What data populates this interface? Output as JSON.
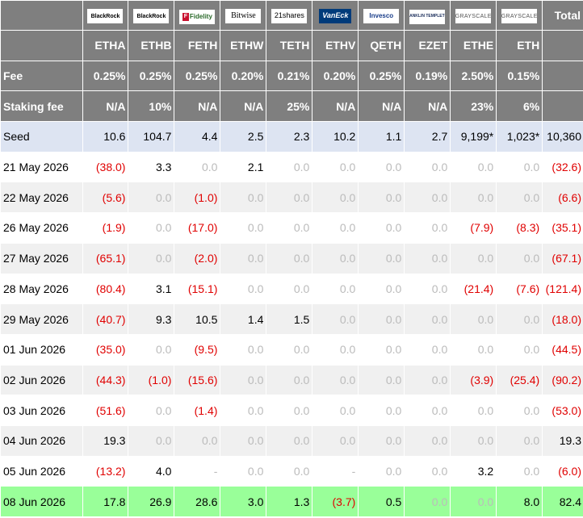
{
  "logos": [
    {
      "name": "blackrock-logo",
      "text": "BlackRock"
    },
    {
      "name": "blackrock-logo",
      "text": "BlackRock"
    },
    {
      "name": "fidelity-logo",
      "text": "Fidelity"
    },
    {
      "name": "bitwise-logo",
      "text": "Bitwise"
    },
    {
      "name": "21shares-logo",
      "text": "21shares"
    },
    {
      "name": "vaneck-logo",
      "text": "VanEck"
    },
    {
      "name": "invesco-logo",
      "text": "Invesco"
    },
    {
      "name": "franklin-templeton-logo",
      "text": "FRANKLIN TEMPLETON"
    },
    {
      "name": "grayscale-logo",
      "text": "GRAYSCALE"
    },
    {
      "name": "grayscale-logo",
      "text": "GRAYSCALE"
    }
  ],
  "total_label": "Total",
  "tickers": [
    "ETHA",
    "ETHB",
    "FETH",
    "ETHW",
    "TETH",
    "ETHV",
    "QETH",
    "EZET",
    "ETHE",
    "ETH"
  ],
  "fee_row": {
    "label": "Fee",
    "values": [
      "0.25%",
      "0.25%",
      "0.25%",
      "0.20%",
      "0.21%",
      "0.20%",
      "0.25%",
      "0.19%",
      "2.50%",
      "0.15%"
    ]
  },
  "staking_row": {
    "label": "Staking fee",
    "values": [
      "N/A",
      "10%",
      "N/A",
      "N/A",
      "25%",
      "N/A",
      "N/A",
      "N/A",
      "23%",
      "6%"
    ]
  },
  "seed_row": {
    "label": "Seed",
    "values": [
      "10.6",
      "104.7",
      "4.4",
      "2.5",
      "2.3",
      "10.2",
      "1.1",
      "2.7",
      "9,199*",
      "1,023*",
      "10,360"
    ]
  },
  "rows": [
    {
      "date": "21 May 2026",
      "values": [
        "(38.0)",
        "3.3",
        "0.0",
        "2.1",
        "0.0",
        "0.0",
        "0.0",
        "0.0",
        "0.0",
        "0.0",
        "(32.6)"
      ]
    },
    {
      "date": "22 May 2026",
      "values": [
        "(5.6)",
        "0.0",
        "(1.0)",
        "0.0",
        "0.0",
        "0.0",
        "0.0",
        "0.0",
        "0.0",
        "0.0",
        "(6.6)"
      ]
    },
    {
      "date": "26 May 2026",
      "values": [
        "(1.9)",
        "0.0",
        "(17.0)",
        "0.0",
        "0.0",
        "0.0",
        "0.0",
        "0.0",
        "(7.9)",
        "(8.3)",
        "(35.1)"
      ]
    },
    {
      "date": "27 May 2026",
      "values": [
        "(65.1)",
        "0.0",
        "(2.0)",
        "0.0",
        "0.0",
        "0.0",
        "0.0",
        "0.0",
        "0.0",
        "0.0",
        "(67.1)"
      ]
    },
    {
      "date": "28 May 2026",
      "values": [
        "(80.4)",
        "3.1",
        "(15.1)",
        "0.0",
        "0.0",
        "0.0",
        "0.0",
        "0.0",
        "(21.4)",
        "(7.6)",
        "(121.4)"
      ]
    },
    {
      "date": "29 May 2026",
      "values": [
        "(40.7)",
        "9.3",
        "10.5",
        "1.4",
        "1.5",
        "0.0",
        "0.0",
        "0.0",
        "0.0",
        "0.0",
        "(18.0)"
      ]
    },
    {
      "date": "01 Jun 2026",
      "values": [
        "(35.0)",
        "0.0",
        "(9.5)",
        "0.0",
        "0.0",
        "0.0",
        "0.0",
        "0.0",
        "0.0",
        "0.0",
        "(44.5)"
      ]
    },
    {
      "date": "02 Jun 2026",
      "values": [
        "(44.3)",
        "(1.0)",
        "(15.6)",
        "0.0",
        "0.0",
        "0.0",
        "0.0",
        "0.0",
        "(3.9)",
        "(25.4)",
        "(90.2)"
      ]
    },
    {
      "date": "03 Jun 2026",
      "values": [
        "(51.6)",
        "0.0",
        "(1.4)",
        "0.0",
        "0.0",
        "0.0",
        "0.0",
        "0.0",
        "0.0",
        "0.0",
        "(53.0)"
      ]
    },
    {
      "date": "04 Jun 2026",
      "values": [
        "19.3",
        "0.0",
        "0.0",
        "0.0",
        "0.0",
        "0.0",
        "0.0",
        "0.0",
        "0.0",
        "0.0",
        "19.3"
      ]
    },
    {
      "date": "05 Jun 2026",
      "values": [
        "(13.2)",
        "4.0",
        "-",
        "0.0",
        "0.0",
        "-",
        "0.0",
        "0.0",
        "3.2",
        "0.0",
        "(6.0)"
      ]
    },
    {
      "date": "08 Jun 2026",
      "values": [
        "17.8",
        "26.9",
        "28.6",
        "3.0",
        "1.3",
        "(3.7)",
        "0.5",
        "0.0",
        "0.0",
        "8.0",
        "82.4"
      ]
    }
  ],
  "colors": {
    "header_bg": "#7f7f7f",
    "seed_bg": "#dde4f2",
    "stripe_bg": "#f0f0f0",
    "latest_bg": "#99ff99",
    "negative": "#e00000",
    "zero": "#bbbbbb"
  }
}
